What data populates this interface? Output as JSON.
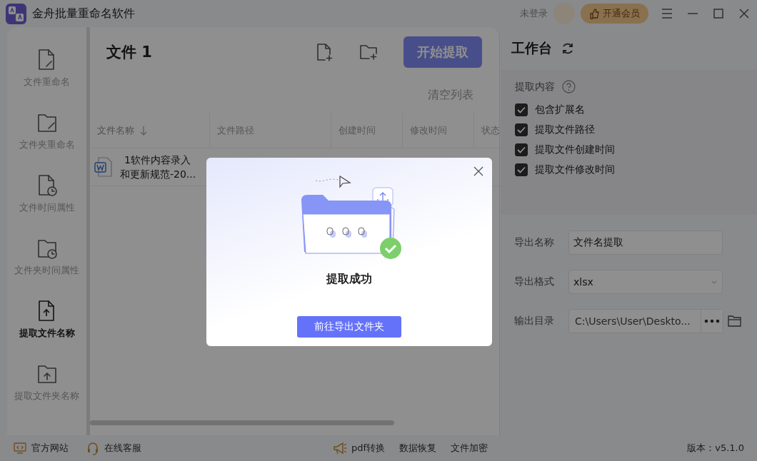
{
  "window": {
    "title": "金舟批量重命名软件",
    "user": "未登录",
    "vip_button": "开通会员"
  },
  "sidebar": {
    "items": [
      {
        "label": "文件重命名",
        "kind": "file-edit",
        "selected": false
      },
      {
        "label": "文件夹重命名",
        "kind": "folder-edit",
        "selected": false
      },
      {
        "label": "文件时间属性",
        "kind": "file-clock",
        "selected": false
      },
      {
        "label": "文件夹时间属性",
        "kind": "folder-clock",
        "selected": false
      },
      {
        "label": "提取文件名称",
        "kind": "file-up",
        "selected": true
      },
      {
        "label": "提取文件夹名称",
        "kind": "folder-up",
        "selected": false
      }
    ]
  },
  "file_panel": {
    "title": "文件 1",
    "start_button": "开始提取",
    "clear_button": "清空列表",
    "table": {
      "columns": [
        {
          "label": "文件名称",
          "sorted": true
        },
        {
          "label": "文件路径"
        },
        {
          "label": "创建时间"
        },
        {
          "label": "修改时间"
        },
        {
          "label": "状态"
        }
      ],
      "rows": [
        {
          "name": "1软件内容录入和更新规范-20...",
          "kind": "word"
        }
      ]
    }
  },
  "workbench": {
    "title": "工作台",
    "content_label": "提取内容",
    "options": [
      {
        "label": "包含扩展名",
        "checked": true
      },
      {
        "label": "提取文件路径",
        "checked": true
      },
      {
        "label": "提取文件创建时间",
        "checked": true
      },
      {
        "label": "提取文件修改时间",
        "checked": true
      }
    ],
    "fields": [
      {
        "kind": "text",
        "label": "导出名称",
        "value": "文件名提取"
      },
      {
        "kind": "select",
        "label": "导出格式",
        "value": "xlsx"
      },
      {
        "kind": "path",
        "label": "输出目录",
        "value": "C:\\Users\\User\\Deskto..."
      }
    ]
  },
  "status_bar": {
    "links": [
      {
        "label": "官方网站",
        "kind": "monitor"
      },
      {
        "label": "在线客服",
        "kind": "headset"
      }
    ],
    "tools": [
      {
        "label": "pdf转换",
        "kind": "megaphone"
      },
      {
        "label": "数据恢复",
        "kind": "plain"
      },
      {
        "label": "文件加密",
        "kind": "plain"
      }
    ],
    "version": "版本：v5.1.0"
  },
  "dialog": {
    "message": "提取成功",
    "button": "前往导出文件夹"
  }
}
